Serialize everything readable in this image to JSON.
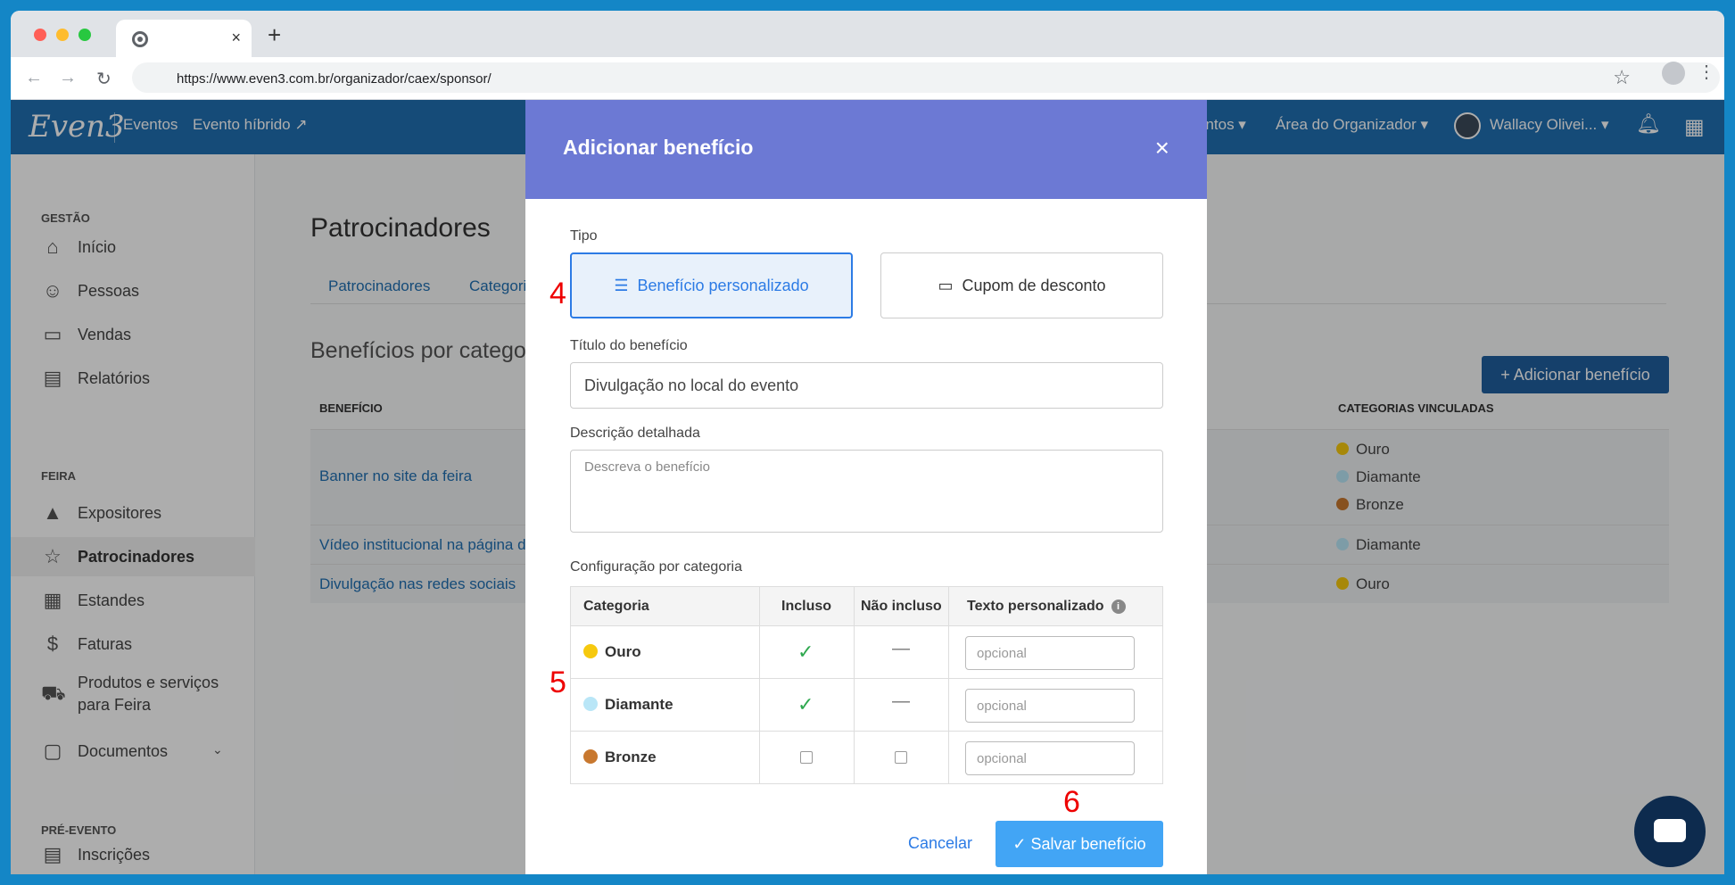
{
  "browser": {
    "url": "https://www.even3.com.br/organizador/caex/sponsor/",
    "tab_close": "×",
    "new_tab": "+"
  },
  "topnav": {
    "brand": "Even3",
    "eventos": "Eventos",
    "evento_hibrido": "Evento híbrido ↗",
    "eventos_menu": "entos ▾",
    "area_organizador": "Área do Organizador ▾",
    "user": "Wallacy Olivei... ▾"
  },
  "sidebar": {
    "gestao": "GESTÃO",
    "feira": "FEIRA",
    "pre_evento": "PRÉ-EVENTO",
    "items": [
      {
        "label": "Início",
        "icon": "⌂"
      },
      {
        "label": "Pessoas",
        "icon": "☺"
      },
      {
        "label": "Vendas",
        "icon": "▭"
      },
      {
        "label": "Relatórios",
        "icon": "▤"
      },
      {
        "label": "Expositores",
        "icon": "▲"
      },
      {
        "label": "Patrocinadores",
        "icon": "☆"
      },
      {
        "label": "Estandes",
        "icon": "▦"
      },
      {
        "label": "Faturas",
        "icon": "$"
      },
      {
        "label": "Produtos e serviços para Feira",
        "icon": "⛟"
      },
      {
        "label": "Documentos",
        "icon": "▢"
      },
      {
        "label": "Inscrições",
        "icon": "▤"
      }
    ]
  },
  "main": {
    "title": "Patrocinadores",
    "tabs": [
      "Patrocinadores",
      "Categori"
    ],
    "subtitle": "Benefícios por catego",
    "add_button": "+ Adicionar benefício",
    "col_beneficio": "BENEFÍCIO",
    "col_categorias": "CATEGORIAS VINCULADAS",
    "rows": [
      {
        "name": "Banner no site da feira",
        "cats": [
          "Ouro",
          "Diamante",
          "Bronze"
        ]
      },
      {
        "name": "Vídeo institucional na página d",
        "cats": [
          "Diamante"
        ]
      },
      {
        "name": "Divulgação nas redes sociais",
        "cats": [
          "Ouro"
        ]
      }
    ]
  },
  "colors": {
    "ouro": "#f6c90e",
    "diamante": "#b9e6f7",
    "bronze": "#c8782f"
  },
  "modal": {
    "title": "Adicionar benefício",
    "close": "×",
    "tipo_label": "Tipo",
    "type_personalizado": "Benefício personalizado",
    "type_cupom": "Cupom de desconto",
    "titulo_label": "Título do benefício",
    "titulo_value": "Divulgação no local do evento",
    "descricao_label": "Descrição detalhada",
    "descricao_placeholder": "Descreva o benefício",
    "config_label": "Configuração por categoria",
    "table": {
      "col_categoria": "Categoria",
      "col_incluso": "Incluso",
      "col_nao_incluso": "Não incluso",
      "col_texto": "Texto personalizado",
      "rows": [
        {
          "categoria": "Ouro",
          "incluso": true,
          "nao_incluso": false,
          "placeholder": "opcional"
        },
        {
          "categoria": "Diamante",
          "incluso": true,
          "nao_incluso": false,
          "placeholder": "opcional"
        },
        {
          "categoria": "Bronze",
          "incluso": false,
          "nao_incluso": false,
          "placeholder": "opcional"
        }
      ]
    },
    "cancel": "Cancelar",
    "save": "Salvar benefício"
  },
  "markers": [
    "4",
    "5",
    "6"
  ]
}
